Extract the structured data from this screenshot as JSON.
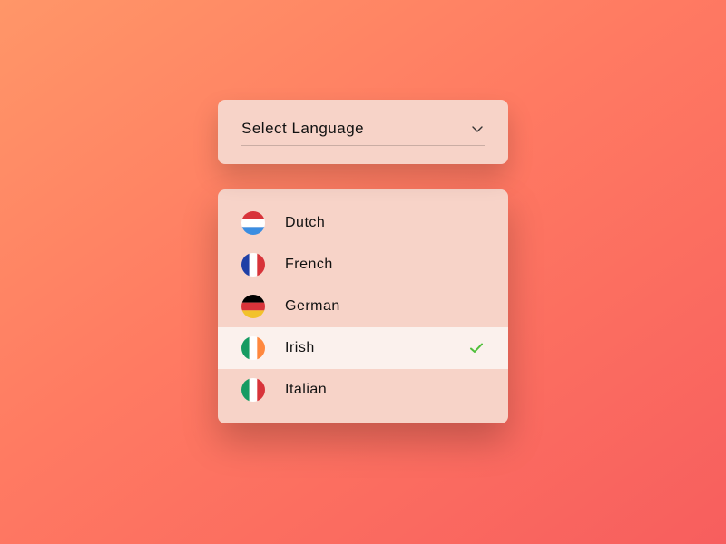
{
  "select": {
    "placeholder": "Select Language"
  },
  "options": [
    {
      "label": "Dutch",
      "flag": "luxembourg",
      "selected": false
    },
    {
      "label": "French",
      "flag": "france",
      "selected": false
    },
    {
      "label": "German",
      "flag": "germany",
      "selected": false
    },
    {
      "label": "Irish",
      "flag": "ireland",
      "selected": true
    },
    {
      "label": "Italian",
      "flag": "italy",
      "selected": false
    }
  ],
  "colors": {
    "checkmark": "#4fbf3a"
  }
}
